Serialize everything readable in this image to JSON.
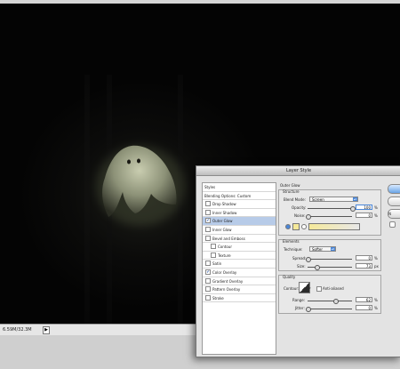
{
  "status": {
    "doc_size": "6.59M/32.3M",
    "arrow": "▶"
  },
  "dialog": {
    "title": "Layer Style",
    "styles_header": "Styles",
    "blending_options": "Blending Options: Custom",
    "effects": [
      {
        "label": "Drop Shadow",
        "checked": false,
        "selected": false,
        "sub": false
      },
      {
        "label": "Inner Shadow",
        "checked": false,
        "selected": false,
        "sub": false
      },
      {
        "label": "Outer Glow",
        "checked": true,
        "selected": true,
        "sub": false
      },
      {
        "label": "Inner Glow",
        "checked": false,
        "selected": false,
        "sub": false
      },
      {
        "label": "Bevel and Emboss",
        "checked": false,
        "selected": false,
        "sub": false
      },
      {
        "label": "Contour",
        "checked": false,
        "selected": false,
        "sub": true
      },
      {
        "label": "Texture",
        "checked": false,
        "selected": false,
        "sub": true
      },
      {
        "label": "Satin",
        "checked": false,
        "selected": false,
        "sub": false
      },
      {
        "label": "Color Overlay",
        "checked": true,
        "selected": false,
        "sub": false
      },
      {
        "label": "Gradient Overlay",
        "checked": false,
        "selected": false,
        "sub": false
      },
      {
        "label": "Pattern Overlay",
        "checked": false,
        "selected": false,
        "sub": false
      },
      {
        "label": "Stroke",
        "checked": false,
        "selected": false,
        "sub": false
      }
    ],
    "outer_glow": {
      "heading": "Outer Glow",
      "structure": {
        "title": "Structure",
        "blend_mode_label": "Blend Mode:",
        "blend_mode_value": "Screen",
        "opacity_label": "Opacity:",
        "opacity_value": "100",
        "noise_label": "Noise:",
        "noise_value": "0",
        "percent": "%"
      },
      "elements": {
        "title": "Elements",
        "technique_label": "Technique:",
        "technique_value": "Softer",
        "spread_label": "Spread:",
        "spread_value": "0",
        "size_label": "Size:",
        "size_value": "73",
        "percent": "%",
        "px": "px"
      },
      "quality": {
        "title": "Quality",
        "contour_label": "Contour:",
        "anti_aliased_label": "Anti-aliased",
        "range_label": "Range:",
        "range_value": "62",
        "jitter_label": "Jitter:",
        "jitter_value": "0",
        "percent": "%"
      }
    },
    "buttons": [
      "",
      "",
      " N"
    ],
    "colors": {
      "glow_color": "#f5e99a",
      "selection": "#b7cbe8",
      "ok_blue": "#6aa4e6"
    }
  }
}
